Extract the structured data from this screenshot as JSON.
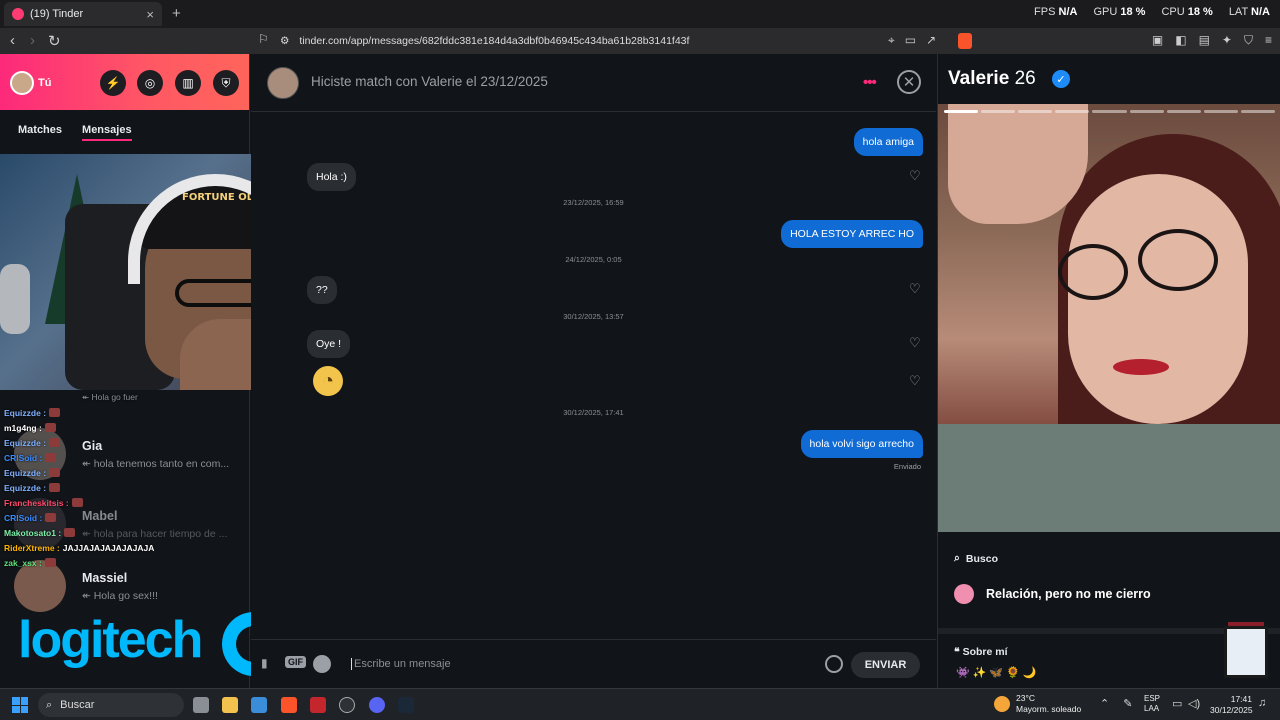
{
  "browser": {
    "tab_title": "(19) Tinder",
    "new_tab": "+",
    "tab_close": "×",
    "url": "tinder.com/app/messages/682fddc381e184d4a3dbf0b46945c434ba61b28b3141f43f",
    "perf": [
      {
        "label": "FPS",
        "value": "N/A"
      },
      {
        "label": "GPU",
        "value": "18 %"
      },
      {
        "label": "CPU",
        "value": "18 %"
      },
      {
        "label": "LAT",
        "value": "N/A"
      }
    ]
  },
  "sidebar": {
    "user_name": "Tú",
    "tabs": [
      "Matches",
      "Mensajes"
    ],
    "matches": [
      {
        "name": "Gia",
        "preview": "↞ hola tenemos tanto en com..."
      },
      {
        "name": "Mabel",
        "preview": "↞ hola para hacer tiempo de ..."
      },
      {
        "name": "Massiel",
        "preview": "↞ Hola go sex!!!"
      }
    ],
    "overlay_partial_preview": "↞ Hola go fuer"
  },
  "stream_chat": [
    {
      "user": "Equizzde",
      "color": "#7fb0ff",
      "text": ""
    },
    {
      "user": "m1g4ng",
      "color": "#ffffff",
      "text": ""
    },
    {
      "user": "Equizzde",
      "color": "#7fb0ff",
      "text": ""
    },
    {
      "user": "CRISoid",
      "color": "#3a8bff",
      "text": ""
    },
    {
      "user": "Equizzde",
      "color": "#7fb0ff",
      "text": ""
    },
    {
      "user": "Equizzde",
      "color": "#7fb0ff",
      "text": ""
    },
    {
      "user": "Francheskitsis",
      "color": "#ff4a6a",
      "text": ""
    },
    {
      "user": "CRISoid",
      "color": "#3a8bff",
      "text": ""
    },
    {
      "user": "Makotosato1",
      "color": "#7ef0a8",
      "text": ""
    },
    {
      "user": "RiderXtreme",
      "color": "#ffb400",
      "text": "JAJJAJAJAJAJAJAJA"
    },
    {
      "user": "zak_xsx",
      "color": "#5ee07a",
      "text": ""
    }
  ],
  "webcam": {
    "cap_text": "FORTUNE OLYMPUS"
  },
  "brand": {
    "logo_text": "logitech",
    "tm": "TM"
  },
  "chat": {
    "header_title": "Hiciste match con Valerie el 23/12/2025",
    "messages": [
      {
        "dir": "out",
        "text": "hola amiga"
      },
      {
        "dir": "in",
        "text": "Hola :)"
      },
      {
        "dir": "stamp",
        "text": "23/12/2025, 16:59"
      },
      {
        "dir": "out",
        "text": "HOLA ESTOY ARREC HO"
      },
      {
        "dir": "stamp",
        "text": "24/12/2025, 0:05"
      },
      {
        "dir": "in",
        "text": "??"
      },
      {
        "dir": "stamp",
        "text": "30/12/2025, 13:57"
      },
      {
        "dir": "in",
        "text": "Oye !"
      },
      {
        "dir": "stamp",
        "text": "30/12/2025, 17:41"
      },
      {
        "dir": "out",
        "text": "hola volvi sigo arrecho"
      }
    ],
    "sent_label": "Enviado",
    "composer": {
      "gif": "GIF",
      "placeholder": "Escribe un mensaje",
      "send": "ENVIAR"
    }
  },
  "profile": {
    "name": "Valerie",
    "age": "26",
    "looking_for_label": "Busco",
    "looking_for_value": "Relación, pero no me cierro",
    "about_label": "Sobre mí",
    "about_emojis": "👾✨🦋🌻🌙"
  },
  "taskbar": {
    "search": "Buscar",
    "weather_temp": "23°C",
    "weather_desc": "Mayorm. soleado",
    "lang1": "ESP",
    "lang2": "LAA",
    "time": "17:41",
    "date": "30/12/2025",
    "notif_badge": "9+"
  }
}
